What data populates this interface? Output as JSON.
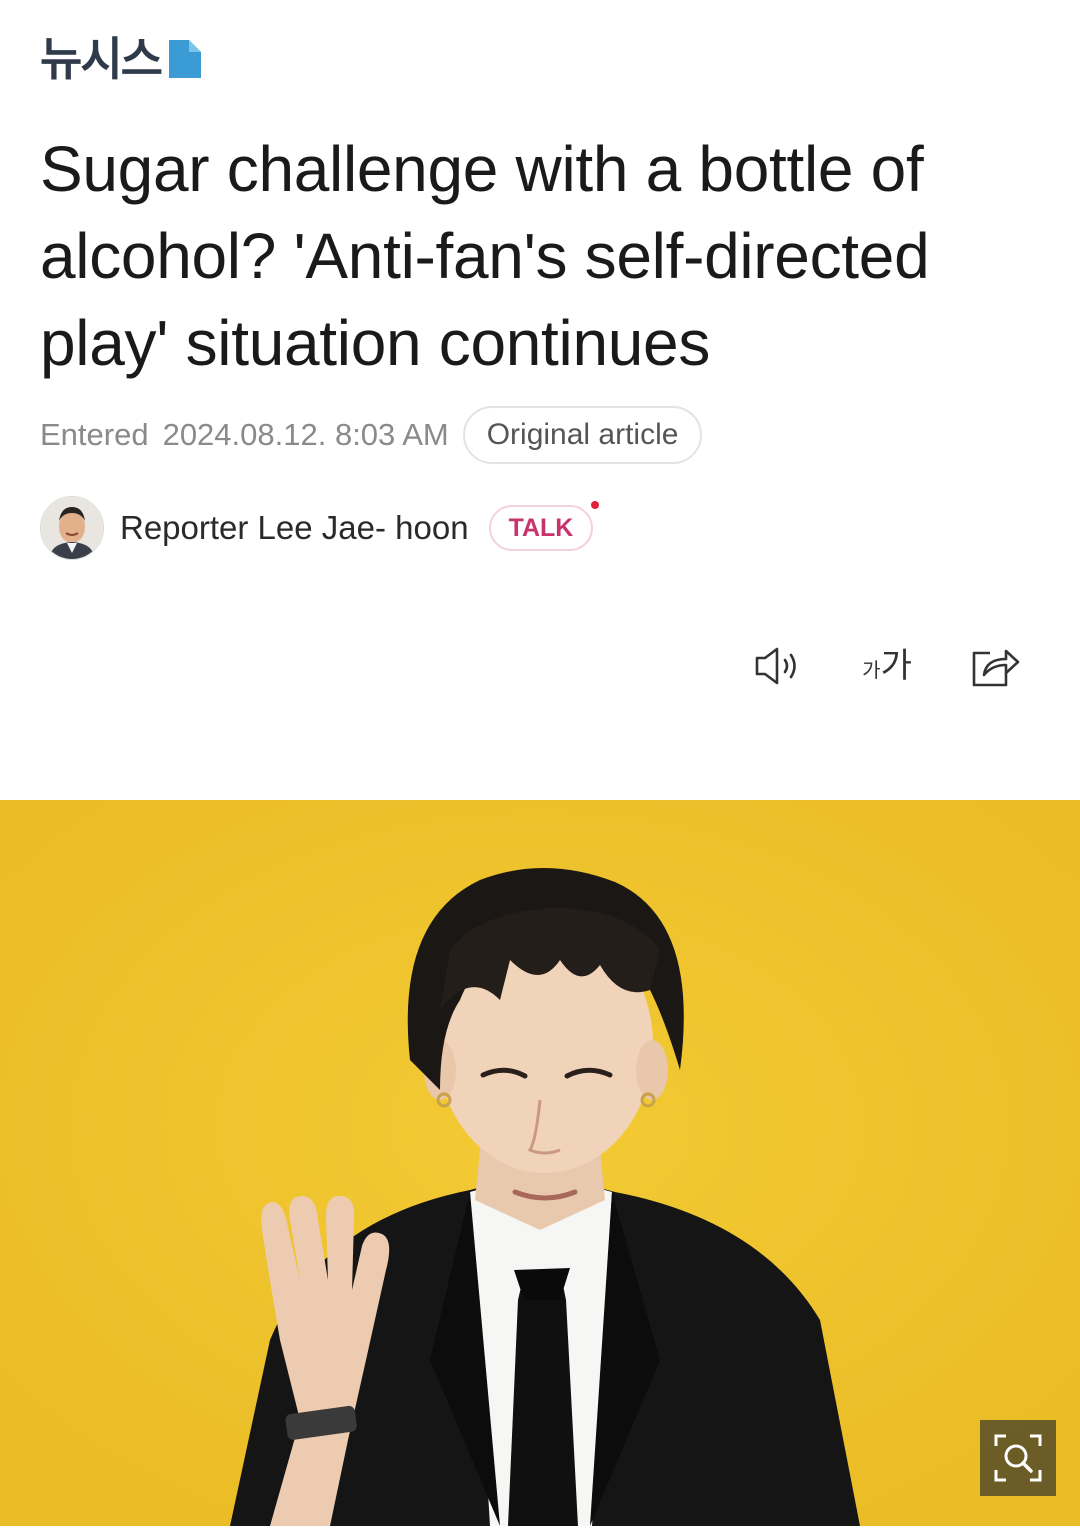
{
  "publisher": {
    "logo_text": "뉴시스",
    "mark_color": "#3a9bd5"
  },
  "article": {
    "headline": "Sugar challenge with a bottle of alcohol? 'Anti-fan's self-directed play' situation continues",
    "entered_label": "Entered",
    "entered_datetime": "2024.08.12. 8:03 AM",
    "original_article_label": "Original article"
  },
  "reporter": {
    "name": "Reporter Lee Jae- hoon",
    "talk_label": "TALK",
    "talk_color": "#c7336b"
  },
  "toolbar": {
    "speaker_icon": "speaker-icon",
    "font_size_icon": "font-size-icon",
    "font_small": "가",
    "font_large": "가",
    "share_icon": "share-icon"
  },
  "photo": {
    "background_color": "#f1c52c",
    "zoom_icon": "zoom-icon"
  }
}
